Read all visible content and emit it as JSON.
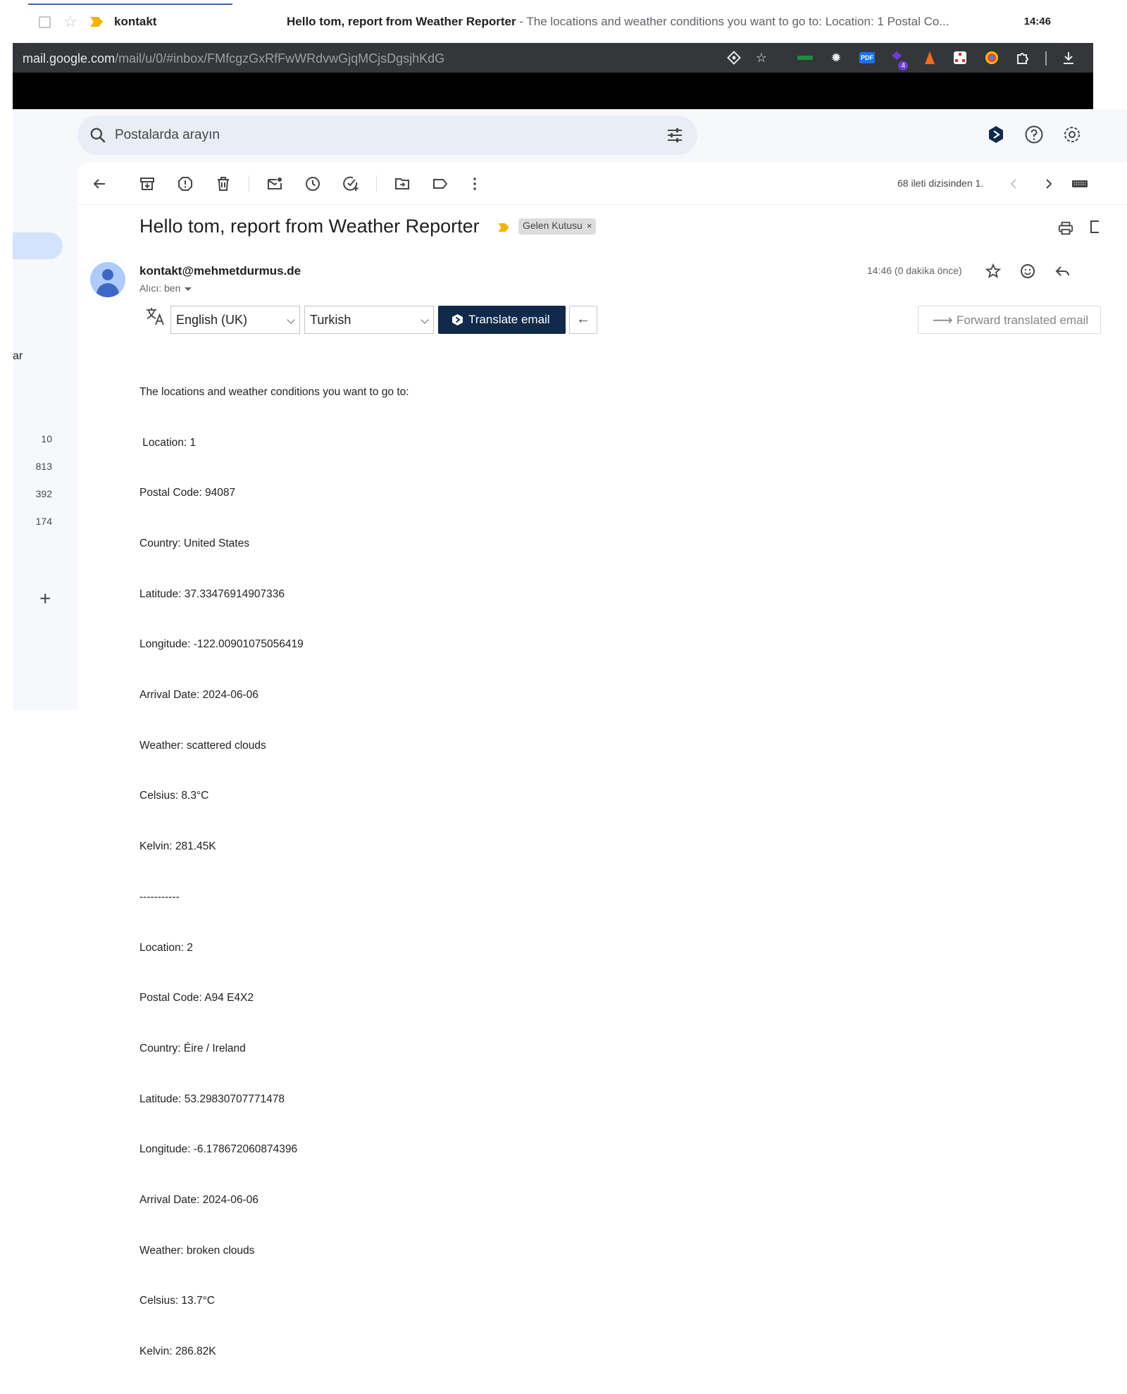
{
  "inbox_row": {
    "sender": "kontakt",
    "subject": "Hello tom, report from Weather Reporter",
    "snippet": " - The locations and weather conditions you want to go to: Location: 1 Postal Co...",
    "time": "14:46"
  },
  "browser": {
    "url_host": "mail.google.com",
    "url_path": "/mail/u/0/#inbox/FMfcgzGxRfFwWRdvwGjqMCjsDgsjhKdG",
    "extension_badge": "4",
    "pdf_label": "PDF"
  },
  "search": {
    "placeholder": "Postalarda arayın"
  },
  "sidebar": {
    "partial_label": "ar",
    "counts": [
      "10",
      "813",
      "392",
      "174"
    ],
    "plus": "+"
  },
  "toolbar": {
    "count_text": "68 ileti dizisinden 1."
  },
  "email": {
    "subject": "Hello tom, report from Weather Reporter",
    "label": "Gelen Kutusu",
    "label_close": "×",
    "from": "kontakt@mehmetdurmus.de",
    "to": "Alıcı: ben",
    "time": "14:46 (0 dakika önce)"
  },
  "translate": {
    "source_lang": "English (UK)",
    "target_lang": "Turkish",
    "translate_button": "Translate email",
    "back_arrow": "←",
    "forward_arrow": "⟶",
    "forward_button": "Forward translated email"
  },
  "body_lines": [
    "The locations and weather conditions you want to go to:",
    " Location: 1",
    "Postal Code: 94087",
    "Country: United States",
    "Latitude: 37.33476914907336",
    "Longitude: -122.00901075056419",
    "Arrival Date: 2024-06-06",
    "Weather: scattered clouds",
    "Celsius: 8.3°C",
    "Kelvin: 281.45K",
    "-----------",
    "Location: 2",
    "Postal Code: A94 E4X2",
    "Country: Éire / Ireland",
    "Latitude: 53.29830707771478",
    "Longitude: -6.178672060874396",
    "Arrival Date: 2024-06-06",
    "Weather: broken clouds",
    "Celsius: 13.7°C",
    "Kelvin: 286.82K"
  ],
  "colors": {
    "accent_button": "#11294a",
    "importance": "#f4b400",
    "nav_active": "#d3e3fd",
    "search_bg": "#e9eef6"
  }
}
